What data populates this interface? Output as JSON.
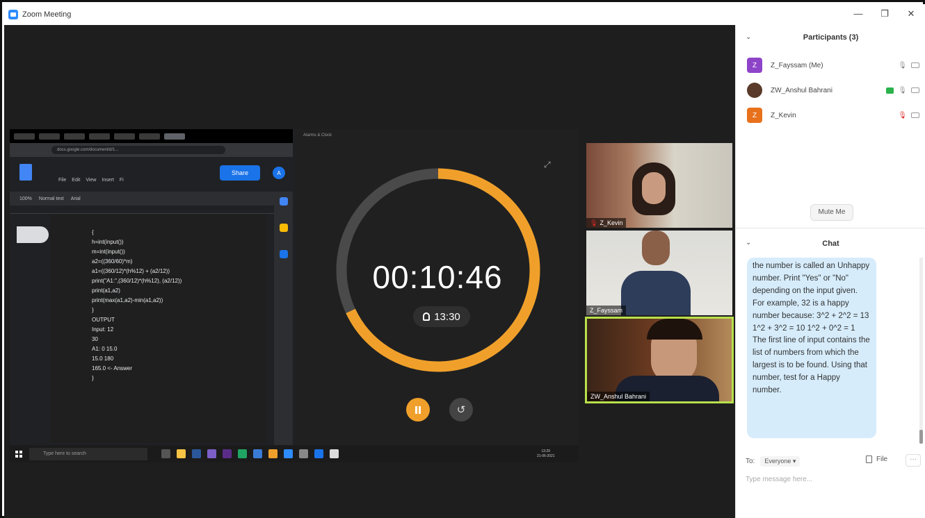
{
  "window": {
    "title": "Zoom Meeting",
    "controls": {
      "minimize": "—",
      "restore": "❐",
      "close": "✕"
    }
  },
  "shared_screen": {
    "browser_url": "docs.google.com/document/d/1...",
    "docs_menu": [
      "File",
      "Edit",
      "View",
      "Insert",
      "Fi"
    ],
    "docs_toolbar": [
      "100%",
      "Normal text",
      "Arial"
    ],
    "share_label": "Share",
    "docs_avatar": "A",
    "code_lines": [
      "{",
      "h=int(input())",
      "m=int(input())",
      "a2=((360/60)*m)",
      "a1=((360/12)*(h%12) + (a2/12))",
      "print(\"A1:\",(360/12)*(h%12), (a2/12))",
      "print(a1,a2)",
      "print(max(a1,a2)-min(a1,a2))",
      "}",
      "OUTPUT",
      "Input: 12",
      "30",
      "A1: 0 15.0",
      "15.0 180",
      "165.0 <- Answer",
      "}"
    ],
    "clock_app_title": "Alarms & Clock",
    "timer": {
      "time": "00:10:46",
      "alarm": "13:30",
      "progress_remaining": 0.68,
      "accent": "#f0a02a"
    },
    "taskbar": {
      "search_placeholder": "Type here to search",
      "time": "13:20",
      "date": "21-06-2021"
    }
  },
  "videos": [
    {
      "name": "Z_Kevin",
      "muted": true
    },
    {
      "name": "Z_Fayssam",
      "muted": false
    },
    {
      "name": "ZW_Anshul Bahrani",
      "muted": false,
      "active_speaker": true
    }
  ],
  "participants": {
    "header": "Participants (3)",
    "list": [
      {
        "initial": "Z",
        "name": "Z_Fayssam (Me)",
        "color": "#8e44c9"
      },
      {
        "initial": "",
        "name": "ZW_Anshul Bahrani",
        "color": "#5a3a2a"
      },
      {
        "initial": "Z",
        "name": "Z_Kevin",
        "color": "#e8711c"
      }
    ],
    "mute_me_label": "Mute Me"
  },
  "chat": {
    "header": "Chat",
    "message": "the number is called an Unhappy number. Print \"Yes\" or \"No\" depending on the input given. For example, 32 is a happy number because: 3^2 + 2^2 = 13 1^2 + 3^2 = 10 1^2 + 0^2 = 1 The first line of input contains the list of numbers from which the largest is to be found. Using that number, test for a Happy number.",
    "to_label": "To:",
    "recipient": "Everyone ▾",
    "file_label": "File",
    "more_label": "···",
    "input_placeholder": "Type message here..."
  }
}
